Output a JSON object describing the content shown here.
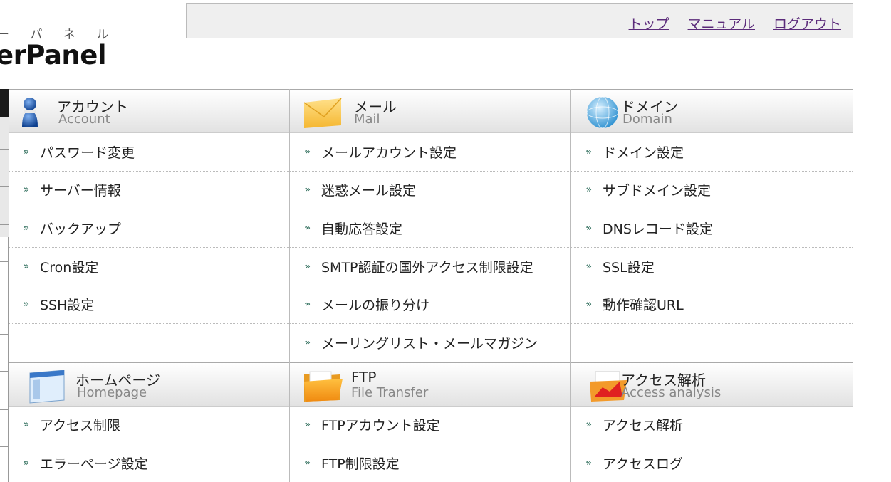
{
  "logo": {
    "kana": "ー パ ネ ル",
    "main": "erPanel"
  },
  "nav": {
    "top": "トップ",
    "manual": "マニュアル",
    "logout": "ログアウト"
  },
  "bullet": "·»",
  "sections": {
    "account": {
      "title_ja": "アカウント",
      "title_en": "Account",
      "items": [
        "パスワード変更",
        "サーバー情報",
        "バックアップ",
        "Cron設定",
        "SSH設定"
      ]
    },
    "mail": {
      "title_ja": "メール",
      "title_en": "Mail",
      "items": [
        "メールアカウント設定",
        "迷惑メール設定",
        "自動応答設定",
        "SMTP認証の国外アクセス制限設定",
        "メールの振り分け",
        "メーリングリスト・メールマガジン"
      ]
    },
    "domain": {
      "title_ja": "ドメイン",
      "title_en": "Domain",
      "items": [
        "ドメイン設定",
        "サブドメイン設定",
        "DNSレコード設定",
        "SSL設定",
        "動作確認URL"
      ]
    },
    "homepage": {
      "title_ja": "ホームページ",
      "title_en": "Homepage",
      "items": [
        "アクセス制限",
        "エラーページ設定"
      ]
    },
    "ftp": {
      "title_ja": "FTP",
      "title_en": "File Transfer",
      "items": [
        "FTPアカウント設定",
        "FTP制限設定"
      ]
    },
    "access": {
      "title_ja": "アクセス解析",
      "title_en": "Access analysis",
      "items": [
        "アクセス解析",
        "アクセスログ"
      ]
    }
  },
  "colors": {
    "nav_link": "#5b2b7a",
    "bullet": "#2a6a58",
    "header_bg": "#efefef"
  }
}
